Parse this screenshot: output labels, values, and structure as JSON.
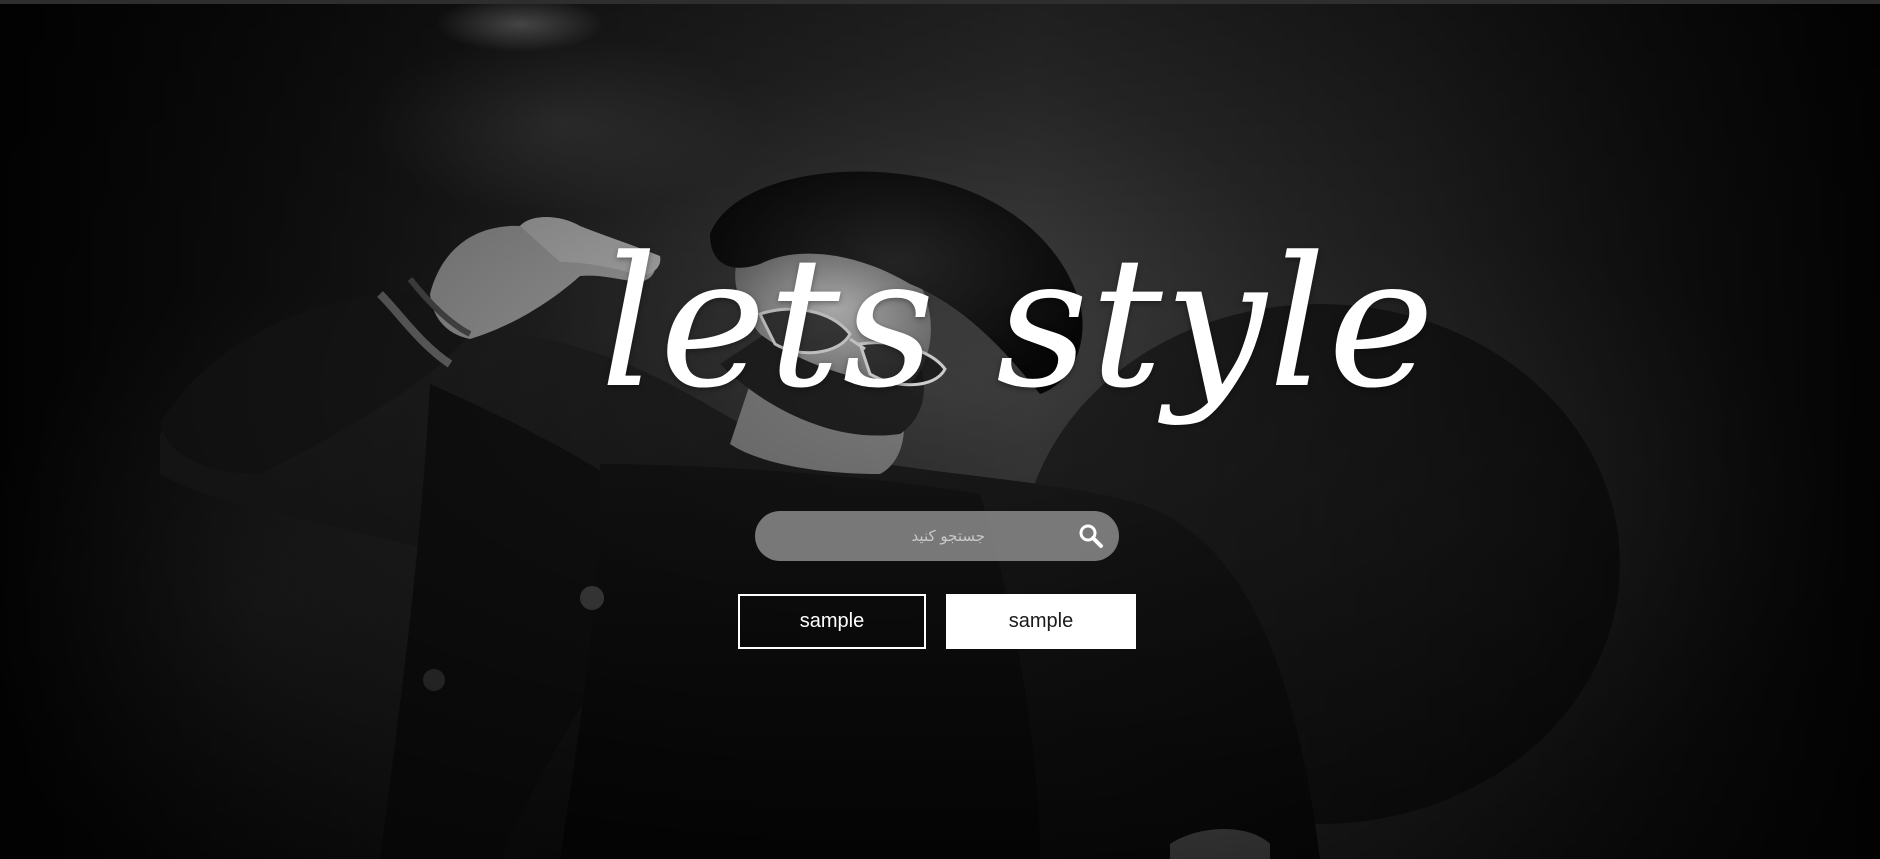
{
  "hero": {
    "title": "lets style"
  },
  "search": {
    "placeholder": "جستجو کنید"
  },
  "buttons": {
    "primary_label": "sample",
    "secondary_label": "sample"
  },
  "colors": {
    "text": "#ffffff",
    "search_bg": "#969696",
    "button_solid_bg": "#ffffff",
    "button_solid_text": "#1a1a1a"
  },
  "icons": {
    "search": "search-icon"
  }
}
